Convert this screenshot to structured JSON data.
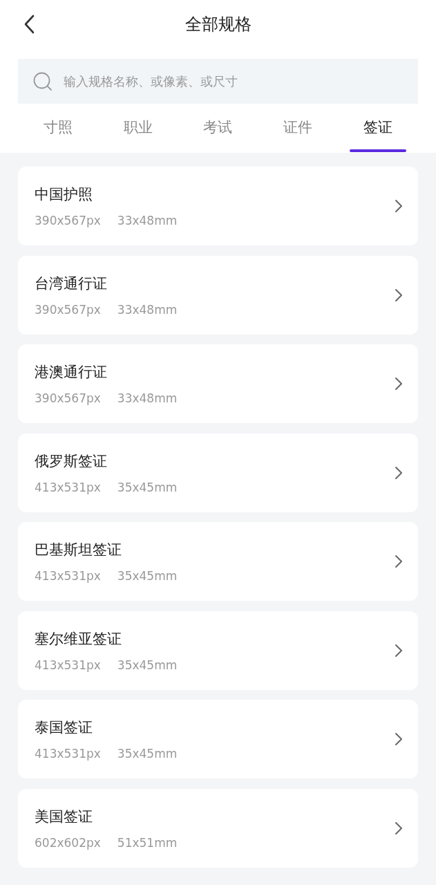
{
  "header": {
    "title": "全部规格"
  },
  "search": {
    "placeholder": "输入规格名称、或像素、或尺寸"
  },
  "tabs": [
    {
      "label": "寸照",
      "selected": false
    },
    {
      "label": "职业",
      "selected": false
    },
    {
      "label": "考试",
      "selected": false
    },
    {
      "label": "证件",
      "selected": false
    },
    {
      "label": "签证",
      "selected": true
    }
  ],
  "specs": [
    {
      "name": "中国护照",
      "pixels": "390x567px",
      "size": "33x48mm"
    },
    {
      "name": "台湾通行证",
      "pixels": "390x567px",
      "size": "33x48mm"
    },
    {
      "name": "港澳通行证",
      "pixels": "390x567px",
      "size": "33x48mm"
    },
    {
      "name": "俄罗斯签证",
      "pixels": "413x531px",
      "size": "35x45mm"
    },
    {
      "name": "巴基斯坦签证",
      "pixels": "413x531px",
      "size": "35x45mm"
    },
    {
      "name": "塞尔维亚签证",
      "pixels": "413x531px",
      "size": "35x45mm"
    },
    {
      "name": "泰国签证",
      "pixels": "413x531px",
      "size": "35x45mm"
    },
    {
      "name": "美国签证",
      "pixels": "602x602px",
      "size": "51x51mm"
    }
  ]
}
